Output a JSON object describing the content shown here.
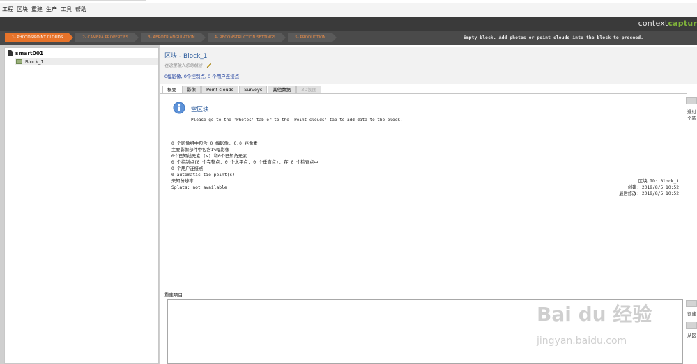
{
  "menubar": {
    "items": [
      "工程",
      "区块",
      "重建",
      "生产",
      "工具",
      "帮助"
    ]
  },
  "toolbar": {
    "icons": [
      "new-file-icon",
      "open-folder-icon",
      "save-icon",
      "export-icon"
    ]
  },
  "brand": {
    "prefix": "context",
    "suffix": "captur"
  },
  "steps": [
    {
      "label": "1- PHOTOS/POINT CLOUDS",
      "active": true
    },
    {
      "label": "2- CAMERA PROPERTIES",
      "active": false
    },
    {
      "label": "3- AEROTRIANGULATION",
      "active": false
    },
    {
      "label": "4- RECONSTRUCTION SETTINGS",
      "active": false
    },
    {
      "label": "5- PRODUCTION",
      "active": false
    }
  ],
  "status_message": "Empty block. Add photos or point clouds into the block to proceed.",
  "tree": {
    "root": "smart001",
    "child": "Block_1"
  },
  "block": {
    "title": "区块 - Block_1",
    "description_placeholder": "在这里输入您的描述",
    "summary": "0幅影像, 0个控制点, 0 个用户连接点"
  },
  "tabs": [
    {
      "label": "概要",
      "state": "active"
    },
    {
      "label": "影像",
      "state": "normal"
    },
    {
      "label": "Point clouds",
      "state": "normal"
    },
    {
      "label": "Surveys",
      "state": "normal"
    },
    {
      "label": "其他数据",
      "state": "normal"
    },
    {
      "label": "3D视图",
      "state": "disabled"
    }
  ],
  "empty": {
    "title": "空区块",
    "hint": "Please go to the 'Photos' tab or to the 'Point clouds' tab to add data to the block."
  },
  "stats": [
    "0 个影像组中包含 0 幅影像, 0.0 兆像素",
    "主要影像部件中包含1%幅影像",
    "0个已知线元素 (s) 和0个已知角元素",
    "0 个控制点(0 个完整点, 0 个水平点, 0 个垂直点), 在 0 个检查点中",
    "0 个用户连接点",
    "0 automatic tie point(s)",
    "未知分辨率",
    "Splats: not available"
  ],
  "meta": {
    "block_id": "区块 ID: Block_1",
    "created": "创建: 2019/8/5 10:52",
    "modified": "最后修改: 2019/8/5 10:52"
  },
  "reconstruction": {
    "label": "重建项目"
  },
  "side_texts": {
    "t1": "通过",
    "t2": "个新",
    "t3": "创建",
    "t4": "从区"
  },
  "watermark": {
    "main": "Bai du 经验",
    "sub": "jingyan.baidu.com"
  },
  "colors": {
    "accent": "#e7732a",
    "link_blue": "#2a5a9b",
    "brand_green": "#7fb23a"
  }
}
